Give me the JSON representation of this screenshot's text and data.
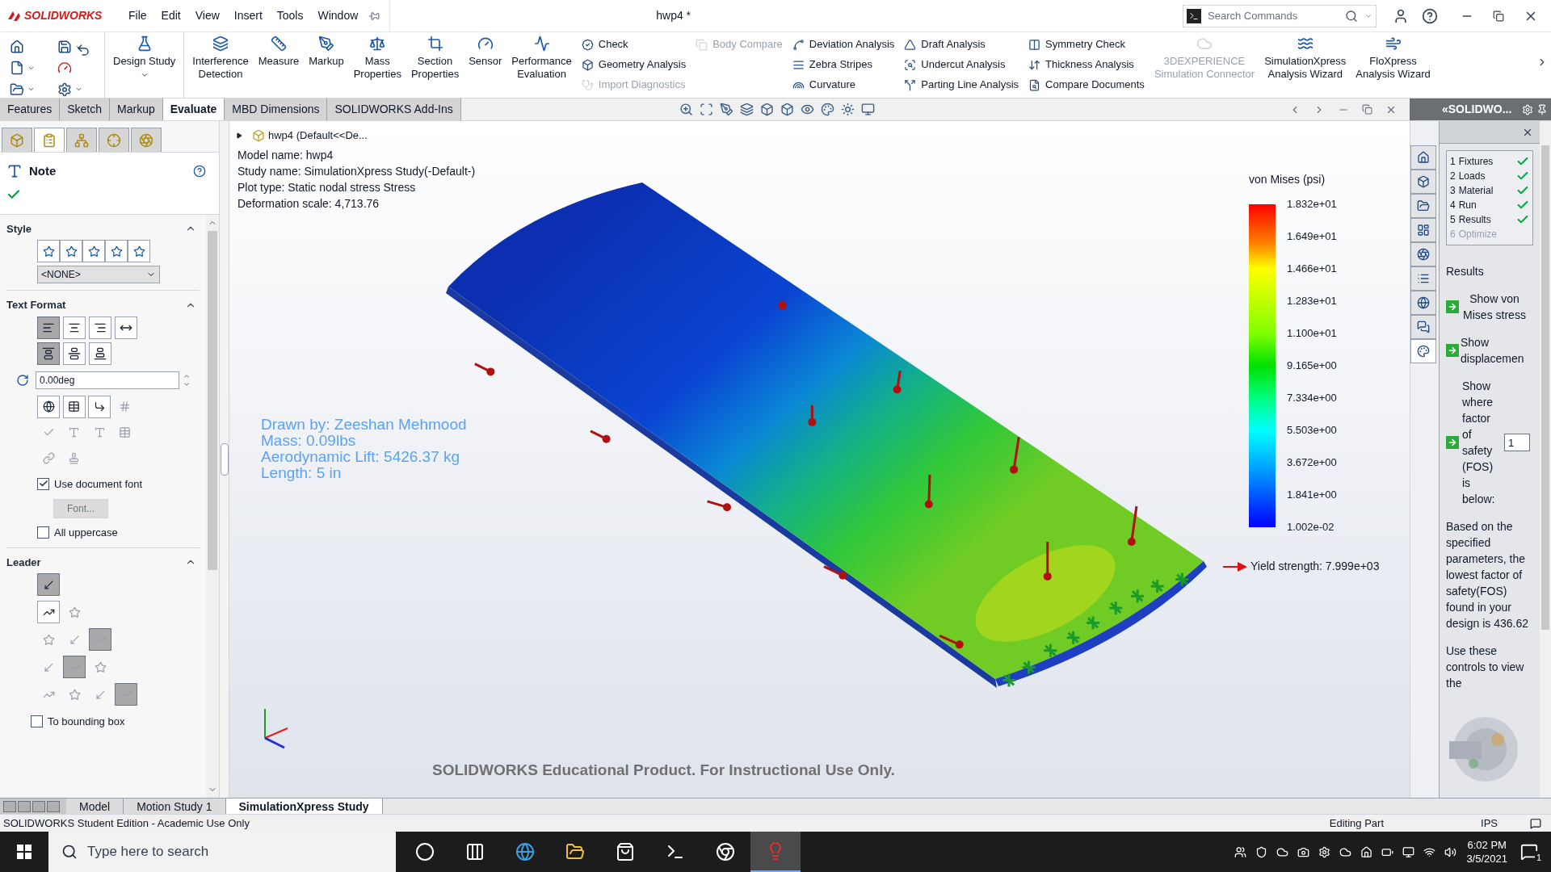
{
  "app_logo": "SOLIDWORKS",
  "menu": [
    "File",
    "Edit",
    "View",
    "Insert",
    "Tools",
    "Window"
  ],
  "document_title": "hwp4 *",
  "search": {
    "placeholder": "Search Commands"
  },
  "ribbon": [
    {
      "kind": "large",
      "label": "Design Study",
      "disabled": false
    },
    {
      "kind": "large",
      "label": "Interference\nDetection",
      "disabled": false
    },
    {
      "kind": "large",
      "label": "Measure",
      "disabled": false
    },
    {
      "kind": "large",
      "label": "Markup",
      "disabled": false
    },
    {
      "kind": "large",
      "label": "Mass\nProperties",
      "disabled": false
    },
    {
      "kind": "large",
      "label": "Section\nProperties",
      "disabled": false
    },
    {
      "kind": "large",
      "label": "Sensor",
      "disabled": false
    },
    {
      "kind": "large",
      "label": "Performance\nEvaluation",
      "disabled": false
    },
    {
      "kind": "column",
      "items": [
        {
          "label": "Check",
          "disabled": false
        },
        {
          "label": "Geometry Analysis",
          "disabled": false
        },
        {
          "label": "Import Diagnostics",
          "disabled": true
        }
      ]
    },
    {
      "kind": "column",
      "items": [
        {
          "label": "Body Compare",
          "disabled": true
        }
      ]
    },
    {
      "kind": "column",
      "items": [
        {
          "label": "Deviation Analysis",
          "disabled": false
        },
        {
          "label": "Zebra Stripes",
          "disabled": false
        },
        {
          "label": "Curvature",
          "disabled": false
        }
      ]
    },
    {
      "kind": "column",
      "items": [
        {
          "label": "Draft Analysis",
          "disabled": false
        },
        {
          "label": "Undercut Analysis",
          "disabled": false
        },
        {
          "label": "Parting Line Analysis",
          "disabled": false
        }
      ]
    },
    {
      "kind": "column",
      "items": [
        {
          "label": "Symmetry Check",
          "disabled": false
        },
        {
          "label": "Thickness Analysis",
          "disabled": false
        },
        {
          "label": "Compare Documents",
          "disabled": false
        }
      ]
    },
    {
      "kind": "large",
      "label": "3DEXPERIENCE\nSimulation Connector",
      "disabled": true
    },
    {
      "kind": "large",
      "label": "SimulationXpress\nAnalysis Wizard",
      "disabled": false
    },
    {
      "kind": "large",
      "label": "FloXpress\nAnalysis Wizard",
      "disabled": false
    }
  ],
  "command_tabs": [
    {
      "label": "Features",
      "selected": false
    },
    {
      "label": "Sketch",
      "selected": false
    },
    {
      "label": "Markup",
      "selected": false
    },
    {
      "label": "Evaluate",
      "selected": true
    },
    {
      "label": "MBD Dimensions",
      "selected": false
    },
    {
      "label": "SOLIDWORKS Add-Ins",
      "selected": false
    }
  ],
  "property_manager": {
    "tabs": [
      {
        "selected": false
      },
      {
        "selected": true
      },
      {
        "selected": false
      },
      {
        "selected": false
      },
      {
        "selected": false
      }
    ],
    "title": "Note",
    "style": {
      "title": "Style",
      "expanded": true,
      "dropdown": "<NONE>"
    },
    "text_format": {
      "title": "Text Format",
      "expanded": true,
      "align_buttons": [
        {
          "selected": true
        },
        {
          "selected": false
        },
        {
          "selected": false
        },
        {
          "selected": false
        }
      ],
      "valign_buttons": [
        {
          "selected": true
        },
        {
          "selected": false
        },
        {
          "selected": false
        }
      ],
      "angle": "0.00deg",
      "tool_buttons": [
        {
          "disabled": false
        },
        {
          "disabled": false
        },
        {
          "disabled": false
        },
        {
          "disabled": true
        },
        {
          "disabled": true
        },
        {
          "disabled": true
        },
        {
          "disabled": true
        },
        {
          "disabled": true
        },
        {
          "disabled": true
        },
        {
          "disabled": true
        }
      ],
      "use_document_font": {
        "label": "Use document font",
        "checked": true
      },
      "font_button": {
        "label": "Font...",
        "disabled": true
      },
      "all_uppercase": {
        "label": "All uppercase",
        "checked": false
      }
    },
    "leader": {
      "title": "Leader",
      "expanded": true,
      "rows": [
        [
          {
            "selected": true,
            "disabled": false
          }
        ],
        [
          {
            "selected": false,
            "disabled": false
          },
          {
            "selected": false,
            "disabled": true
          }
        ],
        [
          {
            "selected": false,
            "disabled": true
          },
          {
            "selected": false,
            "disabled": true
          },
          {
            "selected": true,
            "disabled": true
          }
        ],
        [
          {
            "selected": false,
            "disabled": true
          },
          {
            "selected": true,
            "disabled": true
          },
          {
            "selected": false,
            "disabled": true
          }
        ],
        [
          {
            "selected": false,
            "disabled": true
          },
          {
            "selected": false,
            "disabled": true
          },
          {
            "selected": false,
            "disabled": true
          },
          {
            "selected": true,
            "disabled": true
          }
        ]
      ],
      "to_bounding_box": {
        "label": "To bounding box",
        "checked": false
      }
    }
  },
  "viewport": {
    "tree_node": "hwp4  (Default<<De...",
    "info_lines": [
      "Model name: hwp4",
      "Study name: SimulationXpress Study(-Default-)",
      "Plot type: Static nodal stress Stress",
      "Deformation scale: 4,713.76"
    ],
    "annotation_lines": [
      "Drawn by: Zeeshan Mehmood",
      "Mass: 0.09lbs",
      "Aerodynamic Lift: 5426.37 kg",
      "Length: 5 in"
    ],
    "legend": {
      "title": "von Mises (psi)",
      "labels": [
        "1.832e+01",
        "1.649e+01",
        "1.466e+01",
        "1.283e+01",
        "1.100e+01",
        "9.165e+00",
        "7.334e+00",
        "5.503e+00",
        "3.672e+00",
        "1.841e+00",
        "1.002e-02"
      ]
    },
    "yield_strength": "Yield strength: 7.999e+03",
    "watermark": "SOLIDWORKS Educational Product. For Instructional Use Only."
  },
  "task_tabs": [
    {
      "selected": false
    },
    {
      "selected": false
    },
    {
      "selected": false
    },
    {
      "selected": false
    },
    {
      "selected": false
    },
    {
      "selected": false
    },
    {
      "selected": false
    },
    {
      "selected": false
    },
    {
      "selected": true
    }
  ],
  "simxpress": {
    "header": "«SOLIDWO...",
    "steps": [
      {
        "number": "1",
        "label": "Fixtures",
        "done": true
      },
      {
        "number": "2",
        "label": "Loads",
        "done": true
      },
      {
        "number": "3",
        "label": "Material",
        "done": true
      },
      {
        "number": "4",
        "label": "Run",
        "done": true
      },
      {
        "number": "5",
        "label": "Results",
        "done": true
      },
      {
        "number": "6",
        "label": "Optimize",
        "done": false
      }
    ],
    "heading": "Results",
    "links": [
      "Show von Mises stress",
      "Show displacemen"
    ],
    "fos": {
      "label": "Show where factor of safety (FOS) is below:",
      "value": "1"
    },
    "paragraphs": [
      "Based on the specified parameters, the lowest factor of safety(FOS) found in your design is 436.62",
      "Use these controls to view the"
    ]
  },
  "model_tabs": [
    {
      "label": "Model",
      "selected": false
    },
    {
      "label": "Motion Study 1",
      "selected": false
    },
    {
      "label": "SimulationXpress Study",
      "selected": true
    }
  ],
  "status_bar": {
    "left": "SOLIDWORKS Student Edition - Academic Use Only",
    "mode": "Editing Part",
    "units": "IPS"
  },
  "taskbar": {
    "search_placeholder": "Type here to search",
    "apps": [
      {
        "selected": false
      },
      {
        "selected": false
      },
      {
        "selected": false
      },
      {
        "selected": false
      },
      {
        "selected": false
      },
      {
        "selected": false
      },
      {
        "selected": false
      },
      {
        "selected": true
      }
    ],
    "time": "6:02 PM",
    "date": "3/5/2021",
    "notification_count": "1"
  }
}
